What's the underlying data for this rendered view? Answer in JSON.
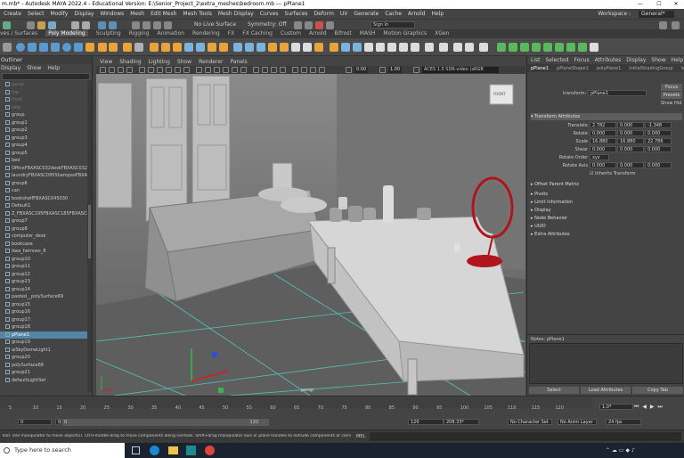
{
  "window": {
    "title": "m.mb* - Autodesk MAYA 2022.4 - Educational Version: E:\\Senior_Project_2\\extra_meshes\\bedroom.mb  ---  pPlane1",
    "min_glyph": "—",
    "max_glyph": "☐",
    "close_glyph": "✕"
  },
  "menubar": {
    "items": [
      "Create",
      "Select",
      "Modify",
      "Display",
      "Windows",
      "Mesh",
      "Edit Mesh",
      "Mesh Tools",
      "Mesh Display",
      "Curves",
      "Surfaces",
      "Deform",
      "UV",
      "Generate",
      "Cache",
      "Arnold",
      "Help"
    ],
    "workspace_label": "Workspace :",
    "workspace_value": "General*"
  },
  "statusline": {
    "no_live_surface": "No Live Surface",
    "symmetry": "Symmetry: Off",
    "sign_in": "Sign In"
  },
  "shelf_tabs": [
    "ves / Surfaces",
    "Poly Modeling",
    "Sculpting",
    "Rigging",
    "Animation",
    "Rendering",
    "FX",
    "FX Caching",
    "Custom",
    "Arnold",
    "Bifrost",
    "MASH",
    "Motion Graphics",
    "XGen"
  ],
  "shelf_active_tab": "Poly Modeling",
  "outliner": {
    "title": "Outliner",
    "menu": [
      "Display",
      "Show",
      "Help"
    ],
    "items": [
      {
        "label": "persp",
        "dim": true
      },
      {
        "label": "top",
        "dim": true
      },
      {
        "label": "front",
        "dim": true
      },
      {
        "label": "side",
        "dim": true
      },
      {
        "label": "group",
        "dim": false
      },
      {
        "label": "group1",
        "dim": false
      },
      {
        "label": "group2",
        "dim": false
      },
      {
        "label": "group3",
        "dim": false
      },
      {
        "label": "group4",
        "dim": false
      },
      {
        "label": "group5",
        "dim": false
      },
      {
        "label": "bed",
        "dim": false
      },
      {
        "label": "OfficeFBXASC032deskFBXASC032FBX",
        "dim": false
      },
      {
        "label": "laundryFBXASC095ShampooFBXASC09",
        "dim": false
      },
      {
        "label": "group6",
        "dim": false
      },
      {
        "label": "can",
        "dim": false
      },
      {
        "label": "bookshelfFBXASC045030",
        "dim": false
      },
      {
        "label": "Default1",
        "dim": false
      },
      {
        "label": "Z_FBXASC195FBXASC185FBXASC046",
        "dim": false
      },
      {
        "label": "group7",
        "dim": false
      },
      {
        "label": "group8",
        "dim": false
      },
      {
        "label": "computer_desk",
        "dim": false
      },
      {
        "label": "bookcase",
        "dim": false
      },
      {
        "label": "ikea_hemnes_8",
        "dim": false
      },
      {
        "label": "group10",
        "dim": false
      },
      {
        "label": "group11",
        "dim": false
      },
      {
        "label": "group12",
        "dim": false
      },
      {
        "label": "group13",
        "dim": false
      },
      {
        "label": "group14",
        "dim": false
      },
      {
        "label": "pasted__polySurface69",
        "dim": false
      },
      {
        "label": "group15",
        "dim": false
      },
      {
        "label": "group16",
        "dim": false
      },
      {
        "label": "group17",
        "dim": false
      },
      {
        "label": "group18",
        "dim": false
      },
      {
        "label": "pPlane1",
        "dim": false,
        "selected": true
      },
      {
        "label": "group19",
        "dim": false
      },
      {
        "label": "aiSkyDomeLight1",
        "dim": false
      },
      {
        "label": "group20",
        "dim": false
      },
      {
        "label": "polySurface68",
        "dim": false
      },
      {
        "label": "group21",
        "dim": false
      },
      {
        "label": "defaultLightSet",
        "dim": false
      }
    ]
  },
  "viewport": {
    "menu": [
      "View",
      "Shading",
      "Lighting",
      "Show",
      "Renderer",
      "Panels"
    ],
    "num1": "0.00",
    "num2": "1.00",
    "colorspace": "ACES 1.0 SDR-video (sRGB",
    "camera_label": "persp",
    "viewcube_label": "FRONT"
  },
  "attribute_editor": {
    "menu": [
      "List",
      "Selected",
      "Focus",
      "Attributes",
      "Display",
      "Show",
      "Help"
    ],
    "tabs": [
      "pPlane1",
      "pPlaneShape1",
      "polyPlane1",
      "initialShadingGroup",
      "lam"
    ],
    "active_tab": "pPlane1",
    "transform_label": "transform:",
    "transform_value": "pPlane1",
    "focus_btn": "Focus",
    "presets_btn": "Presets",
    "show_label": "Show",
    "hide_label": "Hid",
    "section_transform": "Transform Attributes",
    "rows": [
      {
        "label": "Translate",
        "values": [
          "2.782",
          "0.000",
          "-1.348"
        ]
      },
      {
        "label": "Rotate",
        "values": [
          "0.000",
          "0.000",
          "0.000"
        ]
      },
      {
        "label": "Scale",
        "values": [
          "16.880",
          "16.880",
          "22.786"
        ]
      },
      {
        "label": "Shear",
        "values": [
          "0.000",
          "0.000",
          "0.000"
        ]
      }
    ],
    "rotate_order_label": "Rotate Order",
    "rotate_order_value": "xyz",
    "rotate_axis_label": "Rotate Axis",
    "rotate_axis_values": [
      "0.000",
      "0.000",
      "0.000"
    ],
    "inherits_transform": "Inherits Transform",
    "offset_parent": "Offset Parent Matrix",
    "sections": [
      "Pivots",
      "Limit Information",
      "Display",
      "Node Behavior",
      "UUID",
      "Extra Attributes"
    ],
    "notes_label": "Notes:  pPlane1",
    "btn_select": "Select",
    "btn_load": "Load Attributes",
    "btn_copy": "Copy Tab"
  },
  "timeline": {
    "ticks": [
      "5",
      "10",
      "15",
      "20",
      "25",
      "30",
      "35",
      "40",
      "45",
      "50",
      "55",
      "60",
      "65",
      "70",
      "75",
      "80",
      "85",
      "90",
      "95",
      "100",
      "105",
      "110",
      "115",
      "120"
    ],
    "current_frame": "1.0*"
  },
  "range": {
    "start": "0",
    "start2": "0",
    "range_start_label": "0",
    "range_end_label": "120",
    "end": "120",
    "end2": "208.33*",
    "character_set": "No Character Set",
    "anim_layer": "No Anim Layer",
    "fps": "24 fps"
  },
  "command": {
    "help_text": "Tool: Use manipulator to move object(s). Ctrl+middle-drag to move components along normals. Shift+drag manipulator axis or plane handles to extrude components or clone objects. Ctrl+Shift+drag to con",
    "mel_label": "MEL"
  },
  "taskbar": {
    "search_placeholder": "Type here to search"
  }
}
